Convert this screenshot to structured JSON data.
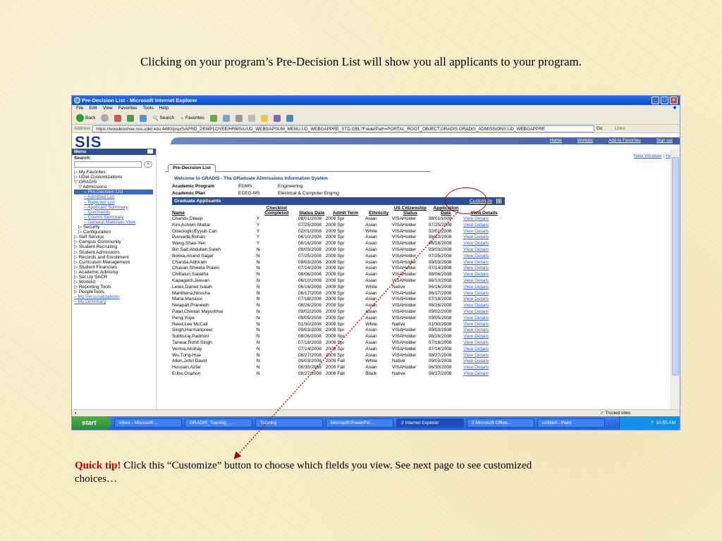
{
  "slide": {
    "title": "Clicking on your program’s Pre-Decision List will show you all applicants to your program.",
    "tip_label": "Quick tip!",
    "tip_text": " Click this “Customize” button to choose which fields you view.  See next page to see customized choices…"
  },
  "window": {
    "title": "Pre-Decision List - Microsoft Internet Explorer"
  },
  "menubar": [
    "File",
    "Edit",
    "View",
    "Favorites",
    "Tools",
    "Help"
  ],
  "toolbar": {
    "back": "Back",
    "search": "Search",
    "favorites": "Favorites"
  },
  "address": {
    "label": "Address",
    "url": "https://woodenshoe.nss.udel.edu:4480/psp/SAPRD_2/EMPLOYEE/HRMS/c/UD_WEBGAPSUM_MENU.UD_WEBGAPPRE_STD.GBL?FolderPath=PORTAL_ROOT_OBJECT.GRADIS.GRADIS_ADMISSIONS.UD_WEBGAPPRE",
    "go": "Go",
    "links": "Links"
  },
  "banner": {
    "logo": "SIS",
    "nav": [
      "Home",
      "Worklist",
      "Add to Favorites",
      "Sign out"
    ]
  },
  "menu": {
    "title": "Menu",
    "search_label": "Search:",
    "items": [
      {
        "label": "▷ My Favorites",
        "cls": ""
      },
      {
        "label": "▷ UDel Customizations",
        "cls": ""
      },
      {
        "label": "▽ GRADIS",
        "cls": ""
      },
      {
        "label": "▽ Admissions",
        "cls": "l2"
      },
      {
        "label": "– Pre-Decision List",
        "cls": "l3 sel"
      },
      {
        "label": "– Admitted List",
        "cls": "l3 link"
      },
      {
        "label": "– Rejected List",
        "cls": "l3 link"
      },
      {
        "label": "– Applicant Summary",
        "cls": "l3 link"
      },
      {
        "label": "– Comments",
        "cls": "l3 link"
      },
      {
        "label": "– Counts Summary",
        "cls": "l3 link"
      },
      {
        "label": "– General Materials View",
        "cls": "l3 link"
      },
      {
        "label": "▷ Security",
        "cls": "l2"
      },
      {
        "label": "▷ Configuration",
        "cls": "l2"
      },
      {
        "label": "▷ Self Service",
        "cls": ""
      },
      {
        "label": "▷ Campus Community",
        "cls": ""
      },
      {
        "label": "▷ Student Recruiting",
        "cls": ""
      },
      {
        "label": "▷ Student Admissions",
        "cls": ""
      },
      {
        "label": "▷ Records and Enrollment",
        "cls": ""
      },
      {
        "label": "▷ Curriculum Management",
        "cls": ""
      },
      {
        "label": "▷ Student Financials",
        "cls": ""
      },
      {
        "label": "▷ Academic Advising",
        "cls": ""
      },
      {
        "label": "▷ Set Up SACR",
        "cls": ""
      },
      {
        "label": "▷ Worklist",
        "cls": ""
      },
      {
        "label": "▷ Reporting Tools",
        "cls": ""
      },
      {
        "label": "▷ PeopleTools",
        "cls": ""
      },
      {
        "label": "– My Personalizations",
        "cls": "link"
      },
      {
        "label": "– My Dictionary",
        "cls": "link"
      }
    ]
  },
  "content": {
    "help_links": [
      "New Window",
      "Help"
    ],
    "tab": "Pre-Decision List",
    "welcome": "Welcome to GRADIS - The GRaduate ADmissions Information System",
    "program": {
      "label": "Academic Program",
      "code": "EGMS",
      "desc": "Engineering"
    },
    "plan": {
      "label": "Academic Plan",
      "code": "ECEG-MS",
      "desc": "Electrical & Computer Engrng"
    },
    "grid_title": "Graduate Applicants",
    "customize": "Customize",
    "columns": [
      "Name",
      "Checklist Completed",
      "Status Date",
      "Admit Term",
      "Ethnicity",
      "US Citizenship Status",
      "Application Date",
      "View Details"
    ],
    "rows": [
      [
        "Chandu,Dileep",
        "Y",
        "08/01/2008",
        "2009 Spr",
        "Asian",
        "VISAHolder",
        "08/01/2008",
        "View Details"
      ],
      [
        "Kini,Ashwin Mattar",
        "Y",
        "07/25/2008",
        "2009 Spr",
        "Asian",
        "VISAHolder",
        "07/25/2008",
        "View Details"
      ],
      [
        "Odacioglu,Eyyub Can",
        "Y",
        "02/01/2008",
        "2009 Spr",
        "White",
        "VISAHolder",
        "02/01/2008",
        "View Details"
      ],
      [
        "Puvvada,Rohan",
        "Y",
        "06/10/2008",
        "2009 Spr",
        "Asian",
        "VISAHolder",
        "06/10/2008",
        "View Details"
      ],
      [
        "Wang,Shao-Yen",
        "Y",
        "06/16/2008",
        "2009 Spr",
        "Asian",
        "VISAHolder",
        "06/16/2008",
        "View Details"
      ],
      [
        "Bin Saif,Abdullah Saleh",
        "N",
        "09/03/2008",
        "2009 Spr",
        "Asian",
        "VISAHolder",
        "09/03/2008",
        "View Details"
      ],
      [
        "Bokka,Anand Sagar",
        "N",
        "07/25/2008",
        "2009 Spr",
        "Asian",
        "VISAHolder",
        "07/25/2008",
        "View Details"
      ],
      [
        "Chanda,Abhiram",
        "N",
        "09/03/2008",
        "2009 Spr",
        "Asian",
        "VISAHolder",
        "09/03/2008",
        "View Details"
      ],
      [
        "Chavan,Shweta Pravin",
        "N",
        "07/14/2008",
        "2009 Spr",
        "Asian",
        "VISAHolder",
        "07/14/2008",
        "View Details"
      ],
      [
        "Chittaluri,Sailatha",
        "N",
        "08/06/2008",
        "2009 Spr",
        "Asian",
        "VISAHolder",
        "08/06/2008",
        "View Details"
      ],
      [
        "Kapaganti,Jeevan",
        "N",
        "06/10/2008",
        "2009 Spr",
        "Asian",
        "VISAHolder",
        "06/10/2008",
        "View Details"
      ],
      [
        "Lewis,Daniel Isaiah",
        "N",
        "06/16/2008",
        "2009 Spr",
        "White",
        "Native",
        "06/16/2008",
        "View Details"
      ],
      [
        "Manthena,Nirosha",
        "N",
        "06/17/2008",
        "2009 Spr",
        "Asian",
        "VISAHolder",
        "06/17/2008",
        "View Details"
      ],
      [
        "Maria,Manasvi",
        "N",
        "07/18/2008",
        "2009 Spr",
        "Asian",
        "VISAHolder",
        "07/18/2008",
        "View Details"
      ],
      [
        "Nelapati,Praneeth",
        "N",
        "08/26/2008",
        "2009 Spr",
        "Asian",
        "VISAHolder",
        "08/26/2008",
        "View Details"
      ],
      [
        "Patel,Chintan Mayurbhai",
        "N",
        "09/02/2008",
        "2009 Spr",
        "Asian",
        "VISAHolder",
        "09/02/2008",
        "View Details"
      ],
      [
        "Peng,Yuye",
        "N",
        "09/05/2008",
        "2009 Spr",
        "Asian",
        "VISAHolder",
        "09/05/2008",
        "View Details"
      ],
      [
        "Reed,Lee McCall",
        "N",
        "01/30/2008",
        "2009 Spr",
        "White",
        "Native",
        "01/30/2008",
        "View Details"
      ],
      [
        "Singh,Harmanpreet",
        "N",
        "09/03/2008",
        "2009 Spr",
        "Asian",
        "VISAHolder",
        "09/03/2008",
        "View Details"
      ],
      [
        "Subburaj,Padmini",
        "N",
        "08/26/2008",
        "2009 Spr",
        "Asian",
        "VISAHolder",
        "08/26/2008",
        "View Details"
      ],
      [
        "Tanwar,Rohit Singh",
        "N",
        "07/18/2008",
        "2009 Spr",
        "Asian",
        "VISAHolder",
        "07/18/2008",
        "View Details"
      ],
      [
        "Verma,Akshay",
        "N",
        "07/14/2008",
        "2009 Spr",
        "Asian",
        "VISAHolder",
        "07/14/2008",
        "View Details"
      ],
      [
        "Wu,Tung-Hua",
        "N",
        "08/27/2008",
        "2009 Spr",
        "Asian",
        "VISAHolder",
        "08/27/2008",
        "View Details"
      ],
      [
        "Allen,John David",
        "N",
        "09/03/2008",
        "2009 Fall",
        "White",
        "Native",
        "09/03/2008",
        "View Details"
      ],
      [
        "Hussain,Azfar",
        "N",
        "06/30/2008",
        "2009 Fall",
        "Asian",
        "VISAHolder",
        "06/30/2008",
        "View Details"
      ],
      [
        "Eribo,Osahon",
        "N",
        "08/27/2008",
        "2008 Fall",
        "Black",
        "Native",
        "08/27/2008",
        "View Details"
      ]
    ]
  },
  "statusbar": {
    "zone": "Trusted sites"
  },
  "taskbar": {
    "start": "start",
    "tasks": [
      "Inbox - Microsoft ...",
      "GRADIS_Training_...",
      "Training",
      "Microsoft PowerPoi...",
      "2 Internet Explorer",
      "2 Microsoft Office...",
      "untitled - Paint"
    ],
    "clock": "10:55 AM"
  }
}
